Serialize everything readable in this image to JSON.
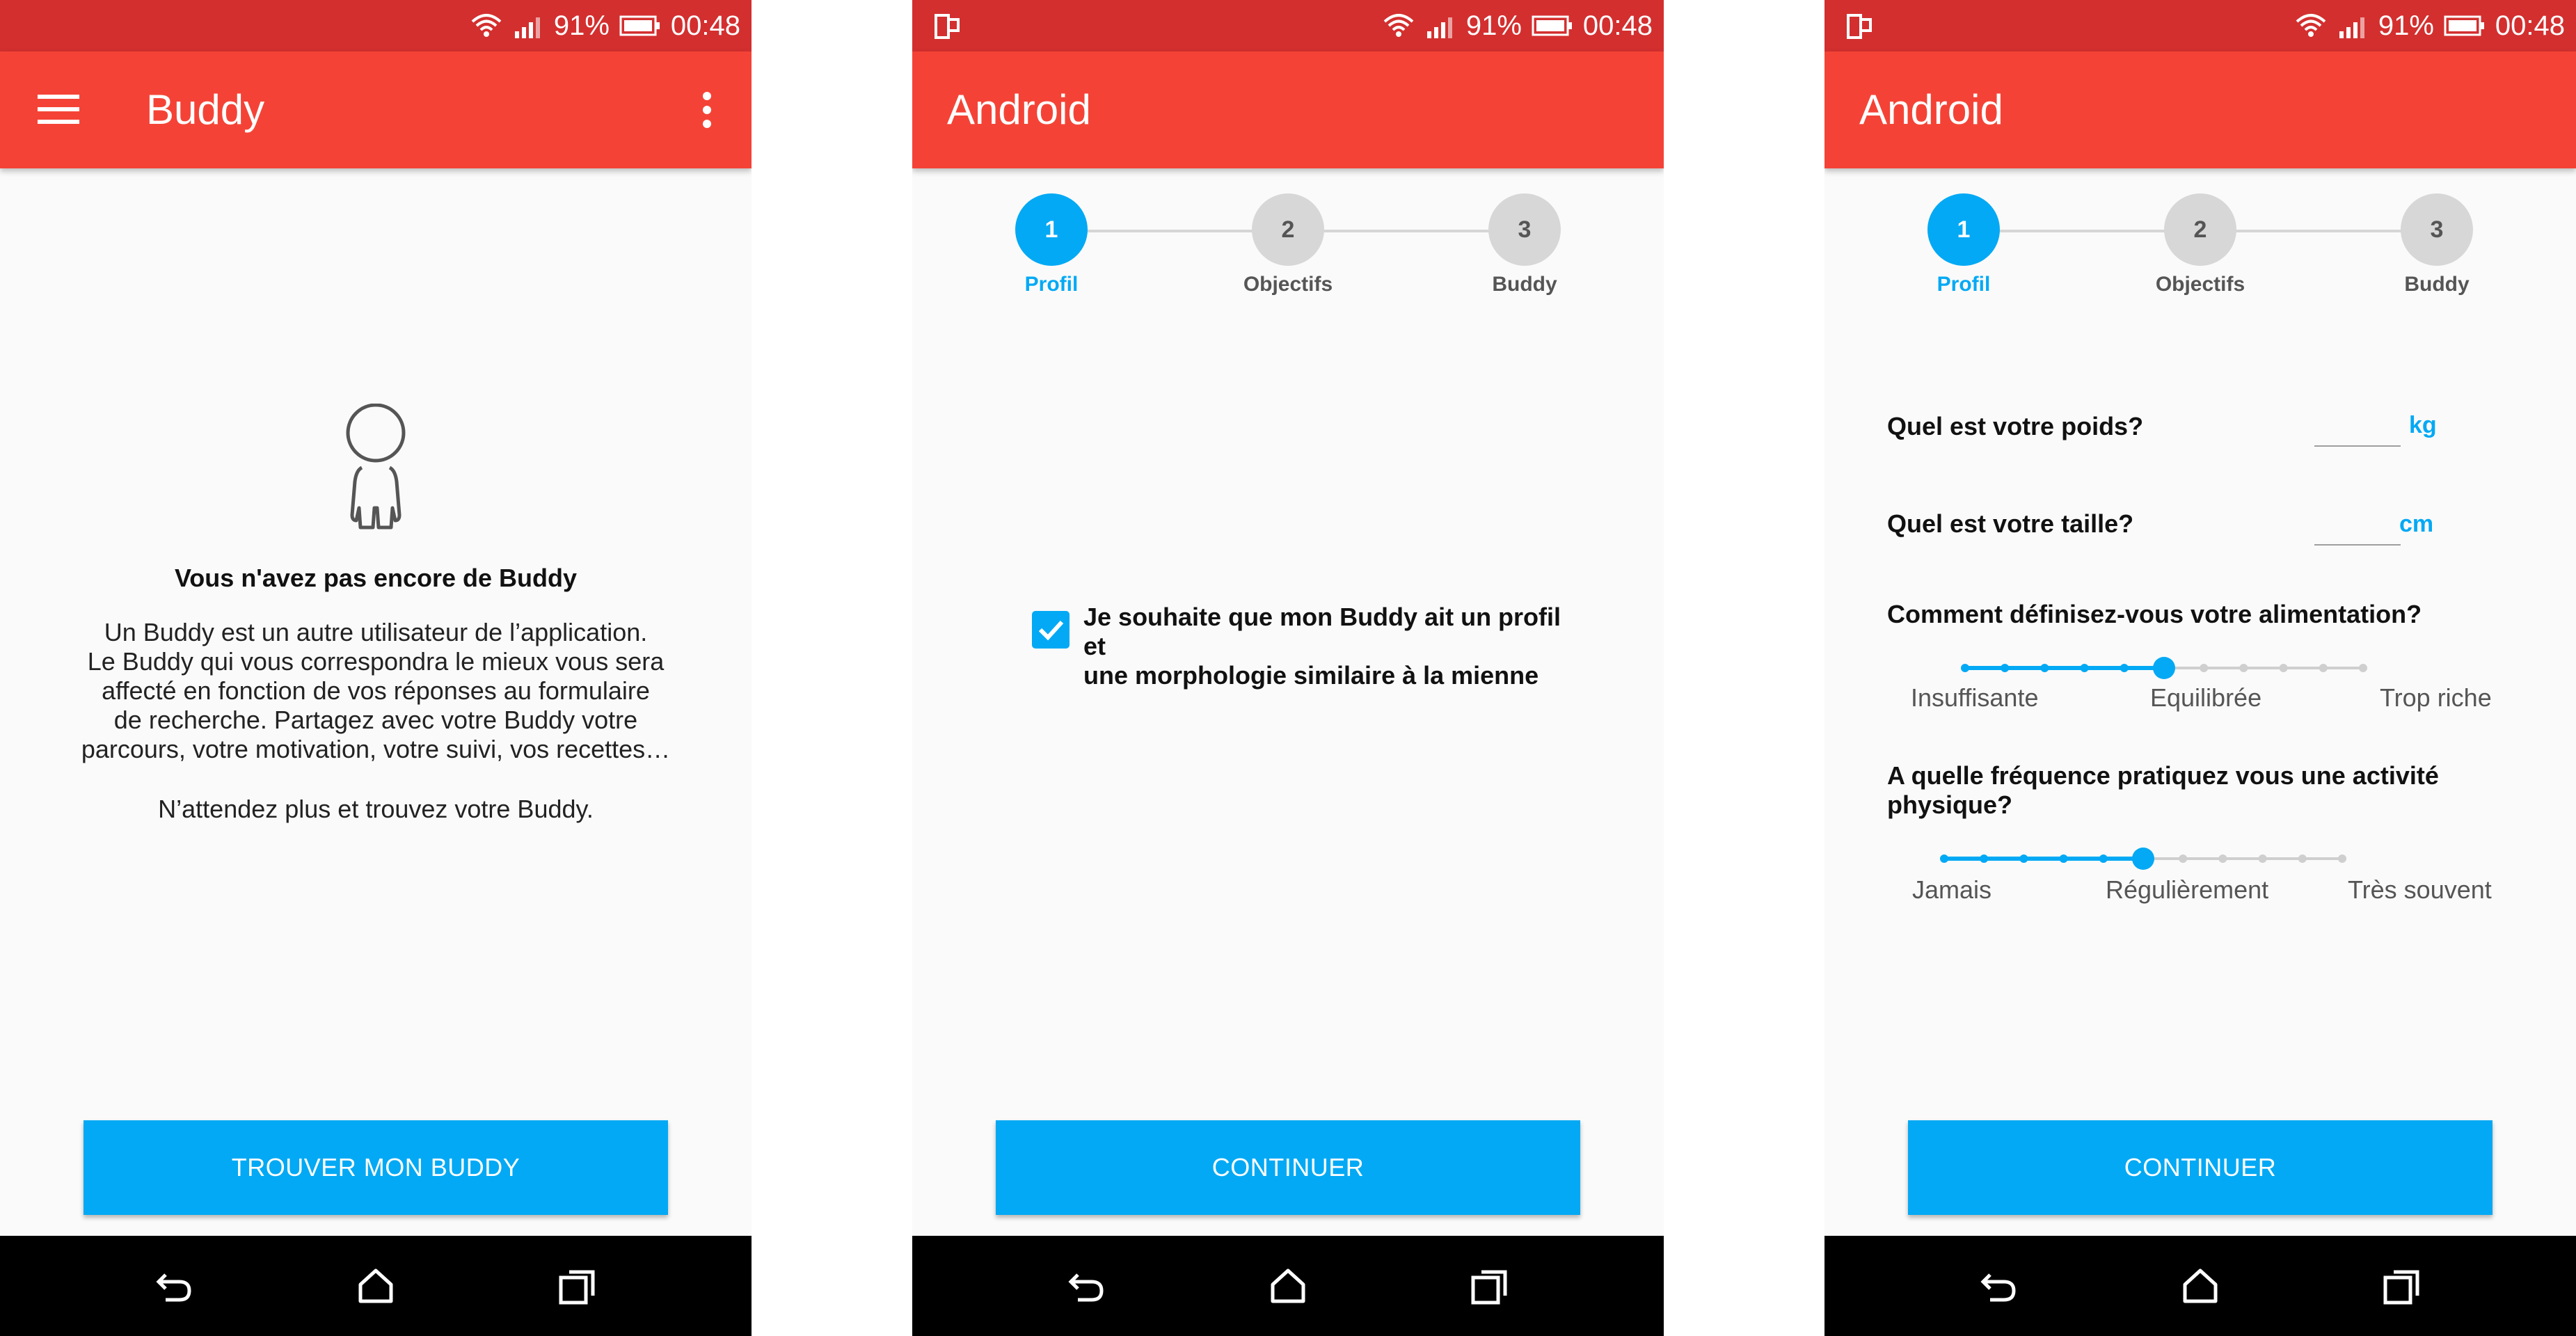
{
  "status": {
    "battery_percent": "91%",
    "time": "00:48"
  },
  "colors": {
    "status_bar": "#d32f2f",
    "app_bar": "#f44336",
    "accent": "#03a9f4",
    "inactive_step": "#d7d7d7"
  },
  "screens": [
    {
      "app_title": "Buddy",
      "icons": [
        "menu-icon",
        "more-vert-icon"
      ],
      "empty_state": {
        "icon": "person-outline-icon",
        "title": "Vous n'avez pas encore de Buddy",
        "body_lines": [
          "Un Buddy est un autre utilisateur de l’application.",
          "Le Buddy qui vous correspondra le mieux vous sera",
          "affecté en fonction de vos réponses au formulaire",
          "de recherche. Partagez avec votre Buddy votre",
          "parcours, votre motivation, votre suivi, vos recettes…"
        ],
        "cta_text": "N’attendez plus et trouvez votre Buddy."
      },
      "button_label": "TROUVER MON BUDDY"
    },
    {
      "app_title": "Android",
      "steps": [
        {
          "number": "1",
          "label": "Profil",
          "active": true
        },
        {
          "number": "2",
          "label": "Objectifs",
          "active": false
        },
        {
          "number": "3",
          "label": "Buddy",
          "active": false
        }
      ],
      "checkbox": {
        "checked": true,
        "label_lines": [
          "Je souhaite que mon Buddy ait un profil et",
          "une morphologie similaire à la mienne"
        ]
      },
      "button_label": "CONTINUER"
    },
    {
      "app_title": "Android",
      "steps": [
        {
          "number": "1",
          "label": "Profil",
          "active": true
        },
        {
          "number": "2",
          "label": "Objectifs",
          "active": false
        },
        {
          "number": "3",
          "label": "Buddy",
          "active": false
        }
      ],
      "form": {
        "weight": {
          "question": "Quel est votre poids?",
          "value": "",
          "unit": "kg"
        },
        "height": {
          "question": "Quel est votre taille?",
          "value": "",
          "unit": "cm"
        },
        "diet": {
          "question": "Comment définisez-vous votre alimentation?",
          "ticks": 11,
          "selected_index": 5,
          "labels": [
            "Insuffisante",
            "Equilibrée",
            "Trop riche"
          ]
        },
        "activity": {
          "question_lines": [
            "A quelle fréquence pratiquez vous une activité",
            "physique?"
          ],
          "ticks": 11,
          "selected_index": 5,
          "labels": [
            "Jamais",
            "Régulièrement",
            "Très souvent"
          ]
        }
      },
      "button_label": "CONTINUER"
    }
  ]
}
